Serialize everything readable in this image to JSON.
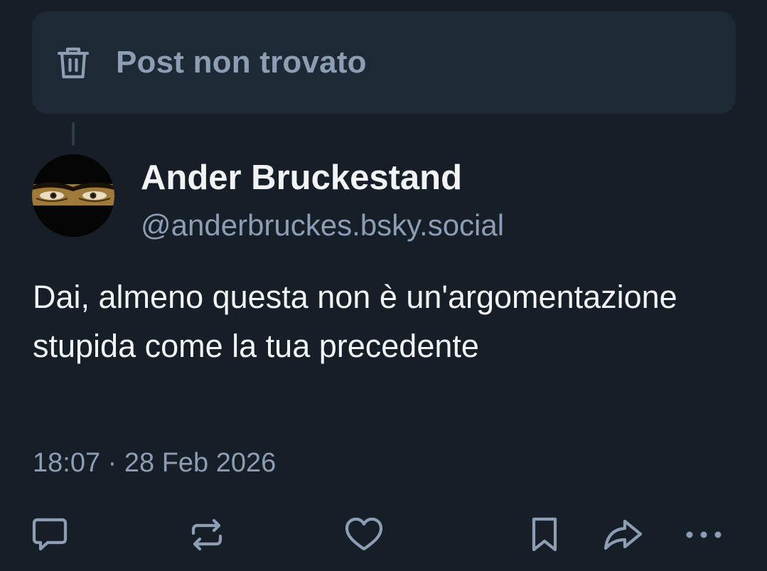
{
  "not_found": {
    "icon": "trash-icon",
    "label": "Post non trovato"
  },
  "author": {
    "name": "Ander Bruckestand",
    "handle": "@anderbruckes.bsky.social",
    "avatar_icon": "eyes-avatar"
  },
  "post": {
    "text": "Dai, almeno questa non è un'argomentazione stupida come la tua precedente",
    "timestamp": "18:07 · 28 Feb 2026"
  },
  "actions": [
    {
      "icon": "reply-icon"
    },
    {
      "icon": "repost-icon"
    },
    {
      "icon": "like-icon"
    },
    {
      "icon": "bookmark-icon"
    },
    {
      "icon": "share-icon"
    },
    {
      "icon": "more-icon"
    }
  ],
  "colors": {
    "background": "#161e27",
    "card": "#1e2936",
    "muted": "#8d9db4",
    "text": "#f1f3f5"
  }
}
